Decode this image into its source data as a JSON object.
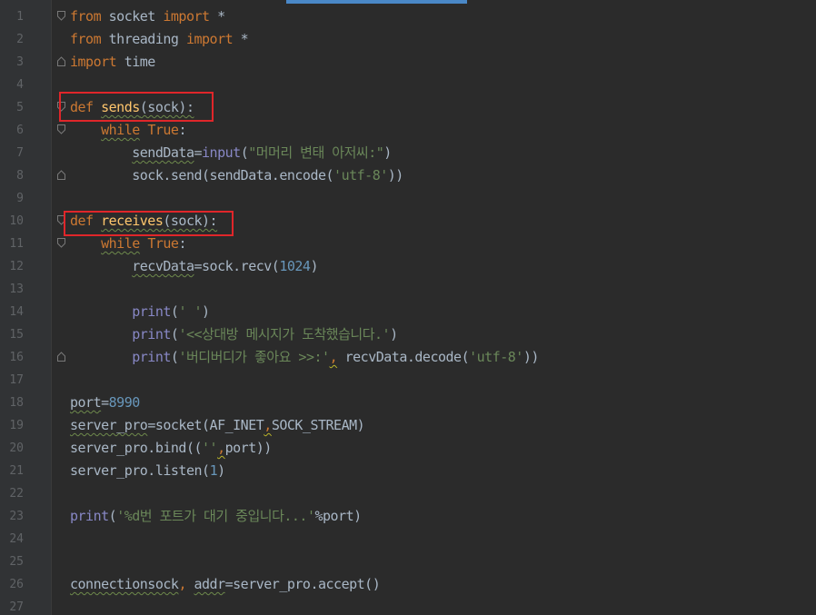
{
  "editor": {
    "lines": [
      {
        "n": "1",
        "tokens": [
          [
            "kw",
            "from"
          ],
          [
            "p",
            " socket "
          ],
          [
            "kw",
            "import"
          ],
          [
            "p",
            " *"
          ]
        ]
      },
      {
        "n": "2",
        "tokens": [
          [
            "kw",
            "from"
          ],
          [
            "p",
            " threading "
          ],
          [
            "kw",
            "import"
          ],
          [
            "p",
            " *"
          ]
        ]
      },
      {
        "n": "3",
        "tokens": [
          [
            "kw",
            "import"
          ],
          [
            "p",
            " time"
          ]
        ]
      },
      {
        "n": "4",
        "tokens": []
      },
      {
        "n": "5",
        "tokens": [
          [
            "kw",
            "def "
          ],
          [
            "fnw",
            "sends"
          ],
          [
            "pw",
            "(sock):"
          ]
        ]
      },
      {
        "n": "6",
        "tokens": [
          [
            "p",
            "    "
          ],
          [
            "kww",
            "while"
          ],
          [
            "p",
            " "
          ],
          [
            "kw",
            "True"
          ],
          [
            "p",
            ":"
          ]
        ]
      },
      {
        "n": "7",
        "tokens": [
          [
            "p",
            "        "
          ],
          [
            "pw",
            "sendData"
          ],
          [
            "p",
            "="
          ],
          [
            "bi",
            "input"
          ],
          [
            "p",
            "("
          ],
          [
            "str",
            "\"머머리 변태 아저씨:\""
          ],
          [
            "p",
            ")"
          ]
        ]
      },
      {
        "n": "8",
        "tokens": [
          [
            "p",
            "        sock.send(sendData.encode("
          ],
          [
            "str",
            "'utf-8'"
          ],
          [
            "p",
            "))"
          ]
        ]
      },
      {
        "n": "9",
        "tokens": []
      },
      {
        "n": "10",
        "tokens": [
          [
            "kw",
            "def "
          ],
          [
            "fnw",
            "receives"
          ],
          [
            "pw",
            "(sock):"
          ]
        ]
      },
      {
        "n": "11",
        "tokens": [
          [
            "p",
            "    "
          ],
          [
            "kww",
            "while"
          ],
          [
            "p",
            " "
          ],
          [
            "kw",
            "True"
          ],
          [
            "p",
            ":"
          ]
        ]
      },
      {
        "n": "12",
        "tokens": [
          [
            "p",
            "        "
          ],
          [
            "pw",
            "recvData"
          ],
          [
            "p",
            "=sock.recv("
          ],
          [
            "num",
            "1024"
          ],
          [
            "p",
            ")"
          ]
        ]
      },
      {
        "n": "13",
        "tokens": []
      },
      {
        "n": "14",
        "tokens": [
          [
            "p",
            "        "
          ],
          [
            "bi",
            "print"
          ],
          [
            "p",
            "("
          ],
          [
            "str",
            "' '"
          ],
          [
            "p",
            ")"
          ]
        ]
      },
      {
        "n": "15",
        "tokens": [
          [
            "p",
            "        "
          ],
          [
            "bi",
            "print"
          ],
          [
            "p",
            "("
          ],
          [
            "str",
            "'<<상대방 메시지가 도착했습니다.'"
          ],
          [
            "p",
            ")"
          ]
        ]
      },
      {
        "n": "16",
        "tokens": [
          [
            "p",
            "        "
          ],
          [
            "bi",
            "print"
          ],
          [
            "p",
            "("
          ],
          [
            "str",
            "'버디버디가 좋아요 >>:'"
          ],
          [
            "kwy",
            ","
          ],
          [
            "p",
            " recvData.decode("
          ],
          [
            "str",
            "'utf-8'"
          ],
          [
            "p",
            "))"
          ]
        ]
      },
      {
        "n": "17",
        "tokens": []
      },
      {
        "n": "18",
        "tokens": [
          [
            "pw",
            "port"
          ],
          [
            "p",
            "="
          ],
          [
            "num",
            "8990"
          ]
        ]
      },
      {
        "n": "19",
        "tokens": [
          [
            "pw",
            "server_pro"
          ],
          [
            "p",
            "=socket(AF_INET"
          ],
          [
            "kwy",
            ","
          ],
          [
            "p",
            "SOCK_STREAM)"
          ]
        ]
      },
      {
        "n": "20",
        "tokens": [
          [
            "p",
            "server_pro.bind(("
          ],
          [
            "str",
            "''"
          ],
          [
            "kwy",
            ","
          ],
          [
            "p",
            "port))"
          ]
        ]
      },
      {
        "n": "21",
        "tokens": [
          [
            "p",
            "server_pro.listen("
          ],
          [
            "num",
            "1"
          ],
          [
            "p",
            ")"
          ]
        ]
      },
      {
        "n": "22",
        "tokens": []
      },
      {
        "n": "23",
        "tokens": [
          [
            "bi",
            "print"
          ],
          [
            "p",
            "("
          ],
          [
            "str",
            "'%d번 포트가 대기 중입니다...'"
          ],
          [
            "p",
            "%port)"
          ]
        ]
      },
      {
        "n": "24",
        "tokens": []
      },
      {
        "n": "25",
        "tokens": []
      },
      {
        "n": "26",
        "tokens": [
          [
            "pw",
            "connectionsock"
          ],
          [
            "kw",
            ","
          ],
          [
            "p",
            " "
          ],
          [
            "pw",
            "addr"
          ],
          [
            "p",
            "=server_pro.accept()"
          ]
        ]
      },
      {
        "n": "27",
        "tokens": []
      }
    ],
    "highlight_color": "#e0262a"
  }
}
